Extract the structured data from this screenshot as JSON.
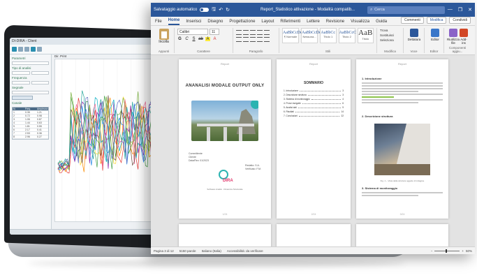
{
  "laptop_app": {
    "title": "DI-DIRA - Client",
    "left_panel": {
      "fields": [
        "Parametri",
        "Tipo di analisi",
        "Frequenza",
        "Segnale",
        "Canale"
      ],
      "table_headers": [
        "N.",
        "Freq.",
        "Ampiezza"
      ],
      "table_rows": [
        [
          "1",
          "0.35",
          "1.21"
        ],
        [
          "2",
          "0.72",
          "0.98"
        ],
        [
          "3",
          "1.06",
          "0.87"
        ],
        [
          "4",
          "1.44",
          "0.63"
        ],
        [
          "5",
          "1.81",
          "0.55"
        ],
        [
          "6",
          "2.17",
          "0.41"
        ],
        [
          "7",
          "2.53",
          "0.36"
        ],
        [
          "8",
          "2.96",
          "0.27"
        ]
      ]
    },
    "chart_label": "Dir. Print"
  },
  "word": {
    "autosave_label": "Salvataggio automatico",
    "doc_name": "Report_Statistico attivazione -  Modalità compatib...",
    "search_placeholder": "Cerca",
    "window_controls": [
      "—",
      "❐",
      "✕"
    ],
    "tabs": [
      "File",
      "Home",
      "Inserisci",
      "Disegno",
      "Progettazione",
      "Layout",
      "Riferimenti",
      "Lettere",
      "Revisione",
      "Visualizza",
      "Guida"
    ],
    "active_tab": "Home",
    "comments_label": "Commenti",
    "edit_label": "Modifica",
    "share_label": "Condividi",
    "ribbon": {
      "paste_label": "Incolla",
      "font_name": "Calibri",
      "font_size": "11",
      "group_labels": [
        "Appunti",
        "Carattere",
        "Paragrafo",
        "Stili",
        "Modifica",
        "Voce",
        "Editor",
        "Componenti aggiu..."
      ],
      "styles": [
        {
          "sample": "AaBbCcDd",
          "name": "¶ Normale"
        },
        {
          "sample": "AaBbCcDd",
          "name": "Nessuna..."
        },
        {
          "sample": "AaBbCc",
          "name": "Titolo 1"
        },
        {
          "sample": "AaBbCcC",
          "name": "Titolo 2"
        },
        {
          "sample": "AaB",
          "name": "Titolo"
        }
      ],
      "edit_items": [
        "Trova",
        "Sostituisci",
        "Seleziona"
      ],
      "big_buttons": [
        "Dettatura",
        "Editor",
        "Riutilizza file",
        "Add-ins"
      ]
    },
    "pages": {
      "cover": {
        "header": "Report",
        "title": "ANANALISI MODALE OUTPUT ONLY",
        "meta_left": [
          "Committente",
          "Cliente",
          "Data/Rev. 01/2023"
        ],
        "meta_right": [
          "Redatto: S.A.",
          "Verificato: F.M."
        ],
        "logo_text": "DIRA",
        "logo_caption": "Software Analisi · Dinamica Strutturale",
        "page_num": "1/24"
      },
      "toc": {
        "header": "Report",
        "title": "SOMMARIO",
        "rows": [
          {
            "label": "1. Introduzione",
            "page": "3"
          },
          {
            "label": "2. Descrizione struttura",
            "page": "3"
          },
          {
            "label": "3. Sistema di monitoraggio",
            "page": "4"
          },
          {
            "label": "4. Prove eseguite",
            "page": "6"
          },
          {
            "label": "5. Analisi dati",
            "page": "9"
          },
          {
            "label": "6. Risultati",
            "page": "14"
          },
          {
            "label": "7. Conclusioni",
            "page": "22"
          }
        ],
        "page_num": "2/24"
      },
      "intro": {
        "header": "Report",
        "heading": "1. Introduzione",
        "sub_heading": "2. Descrizione struttura",
        "caption": "Fig. 1 – Vista della struttura oggetto di indagine",
        "sub_heading2": "3. Sistema di monitoraggio",
        "page_num": "3/24"
      }
    },
    "status": {
      "page": "Pagina 3 di 12",
      "words": "5150 parole",
      "language": "Italiano (Italia)",
      "accessibility": "Accessibilità: da verificare",
      "zoom": "50%"
    }
  }
}
